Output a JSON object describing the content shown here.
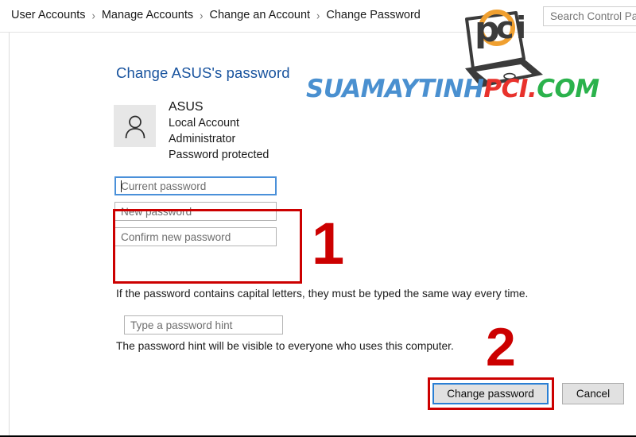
{
  "window": {
    "breadcrumb": {
      "separator": "›",
      "items": [
        "User Accounts",
        "Manage Accounts",
        "Change an Account",
        "Change Password"
      ]
    },
    "search": {
      "placeholder": "Search Control Panel",
      "value": ""
    }
  },
  "main": {
    "title": "Change ASUS's password",
    "account": {
      "avatar_icon": "user-silhouette-icon",
      "name": "ASUS",
      "type": "Local Account",
      "role": "Administrator",
      "status": "Password protected"
    },
    "password_fields": [
      {
        "name": "current-password",
        "placeholder": "Current password",
        "value": "",
        "focused": true
      },
      {
        "name": "new-password",
        "placeholder": "New password",
        "value": "",
        "focused": false
      },
      {
        "name": "confirm-new-password",
        "placeholder": "Confirm new password",
        "value": "",
        "focused": false
      }
    ],
    "caps_note": "If the password contains capital letters, they must be typed the same way every time.",
    "hint_field": {
      "placeholder": "Type a password hint",
      "value": ""
    },
    "hint_note": "The password hint will be visible to everyone who uses this computer.",
    "buttons": {
      "primary": "Change password",
      "secondary": "Cancel"
    }
  },
  "annotations": {
    "color": "#cc0000",
    "step_one": "1",
    "step_two": "2"
  },
  "watermark": {
    "brand_icon": "pci-laptop-logo",
    "logo_text": "pci",
    "text_part_1": "SUAMAYTINH",
    "text_part_2": "PCI.",
    "text_part_3": "COM",
    "color_1": "#4a90d0",
    "color_2": "#e8322c",
    "color_3": "#2bb24c"
  }
}
